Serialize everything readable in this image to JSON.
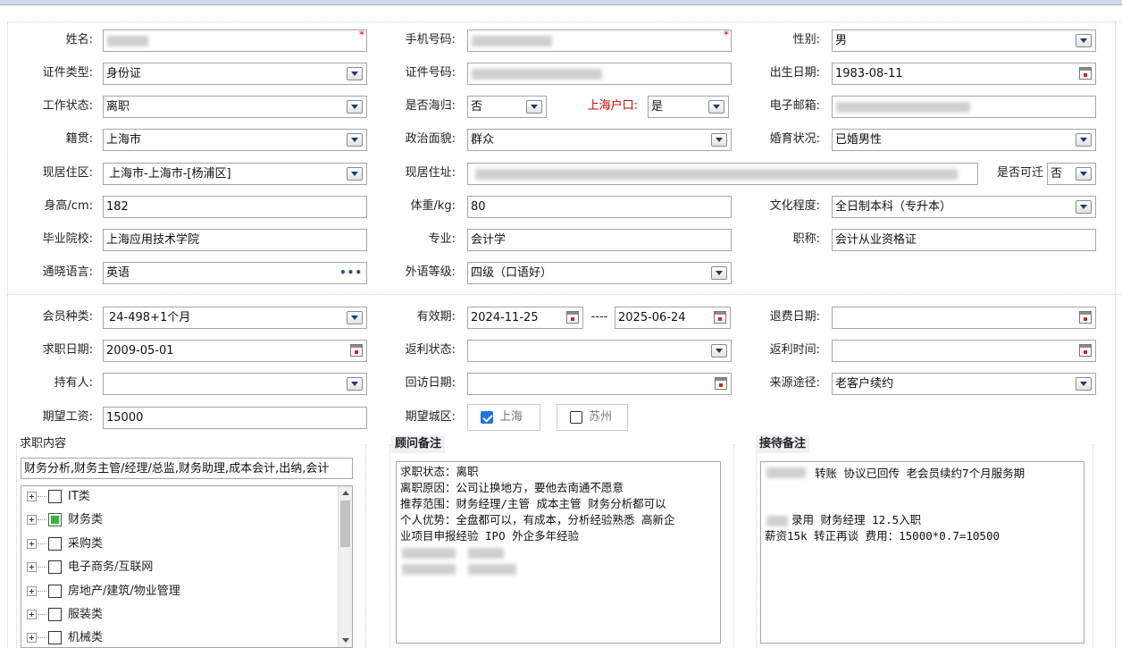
{
  "form": {
    "name_label": "姓名:",
    "mobile_label": "手机号码:",
    "gender_label": "性别:",
    "gender_value": "男",
    "idtype_label": "证件类型:",
    "idtype_value": "身份证",
    "idno_label": "证件号码:",
    "birth_label": "出生日期:",
    "birth_value": "1983-08-11",
    "workstatus_label": "工作状态:",
    "workstatus_value": "离职",
    "returnee_label": "是否海归:",
    "returnee_value": "否",
    "shhukou_label": "上海户口:",
    "shhukou_value": "是",
    "email_label": "电子邮箱:",
    "native_label": "籍贯:",
    "native_value": "上海市",
    "political_label": "政治面貌:",
    "political_value": "群众",
    "marital_label": "婚育状况:",
    "marital_value": "已婚男性",
    "residence_label": "现居住区:",
    "residence_value": "上海市-上海市-[杨浦区]",
    "address_label": "现居住址:",
    "relocate_label": "是否可迁",
    "relocate_value": "否",
    "height_label": "身高/cm:",
    "height_value": "182",
    "weight_label": "体重/kg:",
    "weight_value": "80",
    "education_label": "文化程度:",
    "education_value": "全日制本科（专升本）",
    "school_label": "毕业院校:",
    "school_value": "上海应用技术学院",
    "major_label": "专业:",
    "major_value": "会计学",
    "title_label": "职称:",
    "title_value": "会计从业资格证",
    "language_label": "通晓语言:",
    "language_value": "英语",
    "langlevel_label": "外语等级:",
    "langlevel_value": "四级（口语好）"
  },
  "membership": {
    "type_label": "会员种类:",
    "type_value": "24-498+1个月",
    "valid_label": "有效期:",
    "valid_from": "2024-11-25",
    "valid_sep": "----",
    "valid_to": "2025-06-24",
    "refund_label": "退费日期:",
    "jobdate_label": "求职日期:",
    "jobdate_value": "2009-05-01",
    "rebate_status_label": "返利状态:",
    "rebate_time_label": "返利时间:",
    "holder_label": "持有人:",
    "visit_label": "回访日期:",
    "source_label": "来源途径:",
    "source_value": "老客户续约",
    "salary_label": "期望工资:",
    "salary_value": "15000",
    "city_label": "期望城区:",
    "city_options": [
      {
        "label": "上海",
        "checked": true
      },
      {
        "label": "苏州",
        "checked": false
      }
    ]
  },
  "job_content": {
    "title": "求职内容",
    "summary": "财务分析,财务主管/经理/总监,财务助理,成本会计,出纳,会计",
    "tree": [
      {
        "label": "IT类",
        "checked": false
      },
      {
        "label": "财务类",
        "checked": true
      },
      {
        "label": "采购类",
        "checked": false
      },
      {
        "label": "电子商务/互联网",
        "checked": false
      },
      {
        "label": "房地产/建筑/物业管理",
        "checked": false
      },
      {
        "label": "服装类",
        "checked": false
      },
      {
        "label": "机械类",
        "checked": false
      }
    ]
  },
  "consultant_notes": {
    "title": "顾问备注",
    "lines": [
      "求职状态：离职",
      "离职原因：公司让换地方，要他去南通不愿意",
      "推荐范围：财务经理/主管 成本主管 财务分析都可以",
      "个人优势：全盘都可以，有成本，分析经验熟悉  高新企",
      "业项目申报经验 IPO 外企多年经验"
    ]
  },
  "reception_notes": {
    "title": "接待备注",
    "line1": "转账 协议已回传   老会员续约7个月服务期",
    "line2": "录用 财务经理 12.5入职",
    "line3": "薪资15k 转正再谈 费用：15000*0.7=10500"
  },
  "colors": {
    "label_red": "#d00000",
    "required": "#e00000",
    "checked_blue": "#1a73e8",
    "tree_checked_green": "#3cb043"
  },
  "icons": [
    "dropdown-arrow-icon",
    "calendar-icon",
    "ellipsis-icon",
    "tree-expand-icon"
  ]
}
